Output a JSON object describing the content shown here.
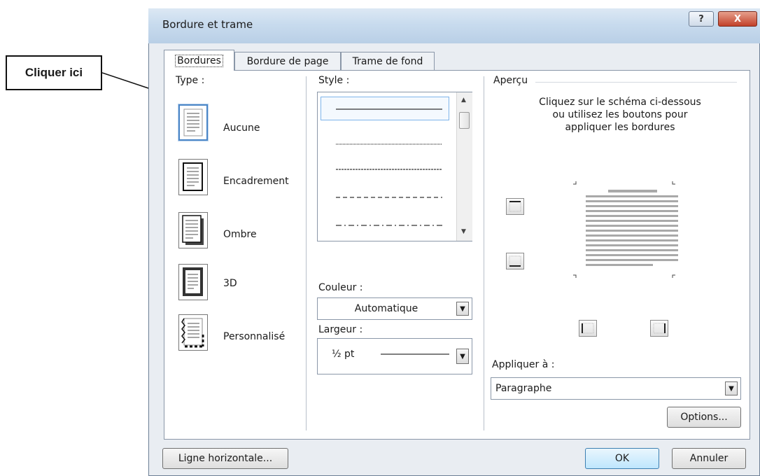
{
  "annotation": {
    "callout_label": "Cliquer ici"
  },
  "dialog": {
    "title": "Bordure et trame",
    "help_button": "?",
    "close_button": "X",
    "tabs": [
      {
        "label": "Bordures",
        "active": true
      },
      {
        "label": "Bordure de page",
        "active": false
      },
      {
        "label": "Trame de fond",
        "active": false
      }
    ],
    "type": {
      "label": "Type :",
      "options": [
        {
          "label": "Aucune",
          "icon": "page-none-icon",
          "selected": true
        },
        {
          "label": "Encadrement",
          "icon": "page-box-icon",
          "selected": false
        },
        {
          "label": "Ombre",
          "icon": "page-shadow-icon",
          "selected": false
        },
        {
          "label": "3D",
          "icon": "page-3d-icon",
          "selected": false
        },
        {
          "label": "Personnalisé",
          "icon": "page-custom-icon",
          "selected": false
        }
      ]
    },
    "style": {
      "label": "Style :",
      "items": [
        "solid",
        "dotted",
        "dashed-fine",
        "dashed",
        "dash-dot"
      ]
    },
    "color": {
      "label": "Couleur :",
      "value": "Automatique"
    },
    "width": {
      "label": "Largeur :",
      "value": "½ pt"
    },
    "preview": {
      "label": "Aperçu",
      "instructions": [
        "Cliquez sur le schéma ci-dessous",
        "ou utilisez les boutons pour",
        "appliquer les bordures"
      ]
    },
    "apply_to": {
      "label": "Appliquer à :",
      "value": "Paragraphe"
    },
    "buttons": {
      "options": "Options...",
      "horizontal_line": "Ligne horizontale...",
      "ok": "OK",
      "cancel": "Annuler"
    },
    "colors": {
      "accent": "#4b86c7",
      "title_bar": "#c8dbee",
      "close": "#c2412a"
    }
  }
}
